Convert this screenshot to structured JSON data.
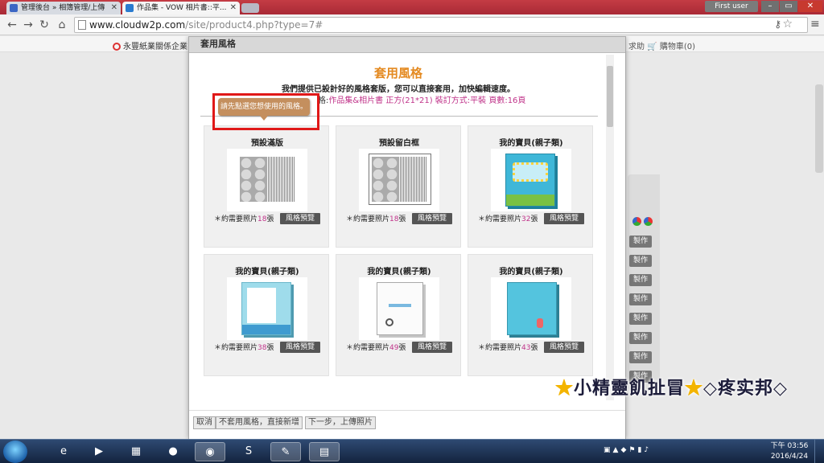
{
  "browser": {
    "tabs": [
      {
        "label": "管理後台 » 相簿管理/上傳",
        "icon_color": "#3b66c4"
      },
      {
        "label": "作品集 - VOW 相片書::平...",
        "icon_color": "#2a7bd0"
      }
    ],
    "user": "First user",
    "address": {
      "domain": "www.cloudw2p.com",
      "path": "/site/product4.php?type=7#"
    }
  },
  "site": {
    "brand": "永豐紙業關係企業",
    "nav": {
      "help": "求助",
      "cart": "購物車(0)"
    },
    "side_buttons": [
      "製作",
      "製作",
      "製作",
      "製作",
      "製作",
      "製作",
      "製作",
      "製作"
    ]
  },
  "modal": {
    "header": "套用風格",
    "title": "套用風格",
    "description": "我們提供已設計好的風格套版，您可以直接套用，加快編輯速度。",
    "spec_prefix": "格:",
    "spec_value": "作品集&相片書 正方(21*21) 裝訂方式:平裝 頁數:16頁",
    "tooltip": "請先點選您想使用的風格。",
    "cards": [
      {
        "title": "預設滿版",
        "photo_prefix": "＊約需要照片",
        "photo_count": "18",
        "photo_suffix": "張",
        "button": "風格預覽"
      },
      {
        "title": "預設留白框",
        "photo_prefix": "＊約需要照片",
        "photo_count": "18",
        "photo_suffix": "張",
        "button": "風格預覽"
      },
      {
        "title": "我的寶貝(親子類)",
        "photo_prefix": "＊約需要照片",
        "photo_count": "32",
        "photo_suffix": "張",
        "button": "風格預覽"
      },
      {
        "title": "我的寶貝(親子類)",
        "photo_prefix": "＊約需要照片",
        "photo_count": "38",
        "photo_suffix": "張",
        "button": "風格預覽"
      },
      {
        "title": "我的寶貝(親子類)",
        "photo_prefix": "＊約需要照片",
        "photo_count": "49",
        "photo_suffix": "張",
        "button": "風格預覽"
      },
      {
        "title": "我的寶貝(親子類)",
        "photo_prefix": "＊約需要照片",
        "photo_count": "43",
        "photo_suffix": "張",
        "button": "風格預覽"
      }
    ],
    "footer": {
      "cancel": "取消",
      "skip": "不套用風格，直接新增",
      "next": "下一步，上傳照片"
    }
  },
  "watermark": {
    "star": "★",
    "text1": "小精靈飢扯冒",
    "text2": "◇疼实邦◇"
  },
  "taskbar": {
    "time": "下午 03:56",
    "date": "2016/4/24"
  },
  "colors": {
    "accent_orange": "#e48a21",
    "spec_pink": "#c0348a",
    "tooltip_brown": "#c48f5e",
    "highlight_red": "#e01818"
  }
}
